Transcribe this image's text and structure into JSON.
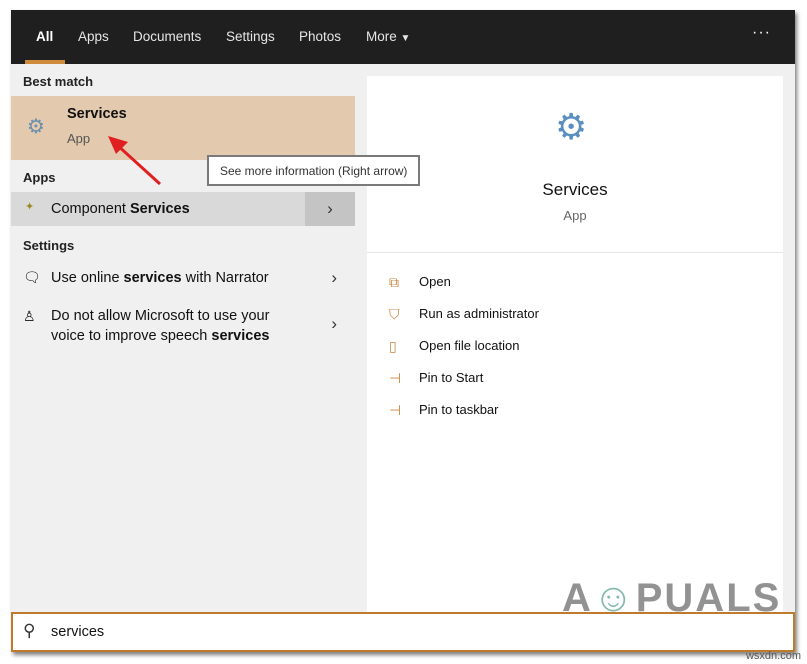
{
  "tabs": [
    {
      "label": "All",
      "active": true
    },
    {
      "label": "Apps"
    },
    {
      "label": "Documents"
    },
    {
      "label": "Settings"
    },
    {
      "label": "Photos"
    },
    {
      "label": "More"
    }
  ],
  "more_icon": "ellipsis-icon",
  "left": {
    "best_match_header": "Best match",
    "best_match": {
      "title": "Services",
      "subtitle": "App",
      "icon": "gears-icon"
    },
    "apps_header": "Apps",
    "apps": [
      {
        "pre": "Component ",
        "bold": "Services"
      }
    ],
    "settings_header": "Settings",
    "settings": [
      {
        "line1_pre": "Use online ",
        "line1_bold": "services",
        "line1_post": " with Narrator"
      },
      {
        "line1_pre": "Do not allow Microsoft to use your",
        "line2_pre": "voice to improve speech ",
        "line2_bold": "services"
      }
    ]
  },
  "tooltip": "See more information (Right arrow)",
  "detail": {
    "title": "Services",
    "subtitle": "App",
    "actions": [
      {
        "label": "Open",
        "icon": "open-icon"
      },
      {
        "label": "Run as administrator",
        "icon": "shield-icon"
      },
      {
        "label": "Open file location",
        "icon": "folder-icon"
      },
      {
        "label": "Pin to Start",
        "icon": "pin-icon"
      },
      {
        "label": "Pin to taskbar",
        "icon": "pin-icon"
      }
    ]
  },
  "search": {
    "value": "services"
  },
  "watermark": "A PUALS",
  "credit": "wsxdn.com",
  "accent": "#d08a3c"
}
